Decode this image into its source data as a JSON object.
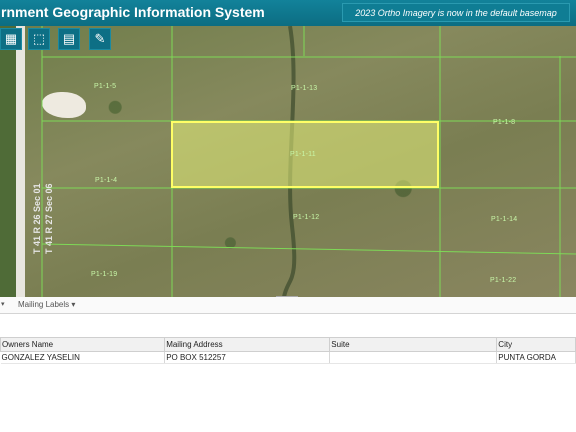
{
  "header": {
    "title": "rnment Geographic Information System",
    "notice": "2023 Ortho Imagery is now in the default basemap"
  },
  "toolbar": {
    "tools": [
      {
        "name": "grid-icon",
        "glyph": "▦"
      },
      {
        "name": "select-box-icon",
        "glyph": "⬚"
      },
      {
        "name": "notes-icon",
        "glyph": "▤"
      },
      {
        "name": "pencil-icon",
        "glyph": "✎"
      }
    ]
  },
  "map": {
    "parcels": [
      "P1-1-5",
      "P1-1-13",
      "P1-1-8",
      "P1-1-11",
      "P1-1-4",
      "P1-1-12",
      "P1-1-14",
      "P1-1-19",
      "P1-1-22"
    ],
    "section_labels": [
      "T 41 R 26 Sec 01",
      "T 41 R 27 Sec 06"
    ],
    "selected_parcel": "P1-1-11",
    "colors": {
      "parcel_line": "#7ed957",
      "selection_fill": "#e6f07a",
      "selection_border": "#ffff66"
    }
  },
  "tabbar": {
    "tab_label": "Mailing Labels ▾",
    "arrow": "▾"
  },
  "table": {
    "columns": [
      "Owners Name",
      "Mailing Address",
      "Suite",
      "City"
    ],
    "rows": [
      [
        "GONZALEZ YASELIN",
        "PO BOX 512257",
        "",
        "PUNTA GORDA"
      ]
    ]
  }
}
